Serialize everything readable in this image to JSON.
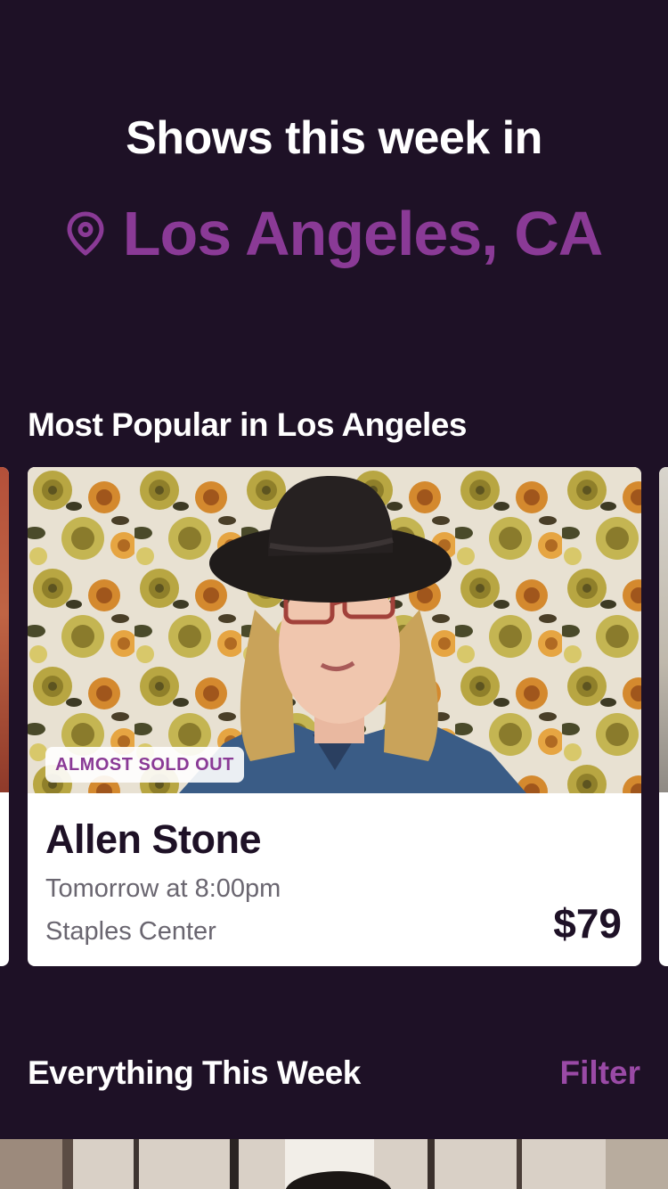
{
  "header": {
    "headline": "Shows this week in",
    "location": "Los Angeles, CA",
    "location_icon": "location-pin-icon"
  },
  "popular": {
    "title": "Most Popular in Los Angeles",
    "cards": [
      {
        "badge": "ALMOST SOLD OUT",
        "artist": "Allen Stone",
        "when": "Tomorrow at 8:00pm",
        "venue": "Staples Center",
        "price": "$79"
      }
    ]
  },
  "week": {
    "title": "Everything This Week",
    "filter_label": "Filter"
  },
  "colors": {
    "background": "#1e1126",
    "accent": "#8a3a96",
    "text_primary": "#ffffff",
    "card_text": "#1e1126",
    "card_secondary": "#6a6670"
  }
}
